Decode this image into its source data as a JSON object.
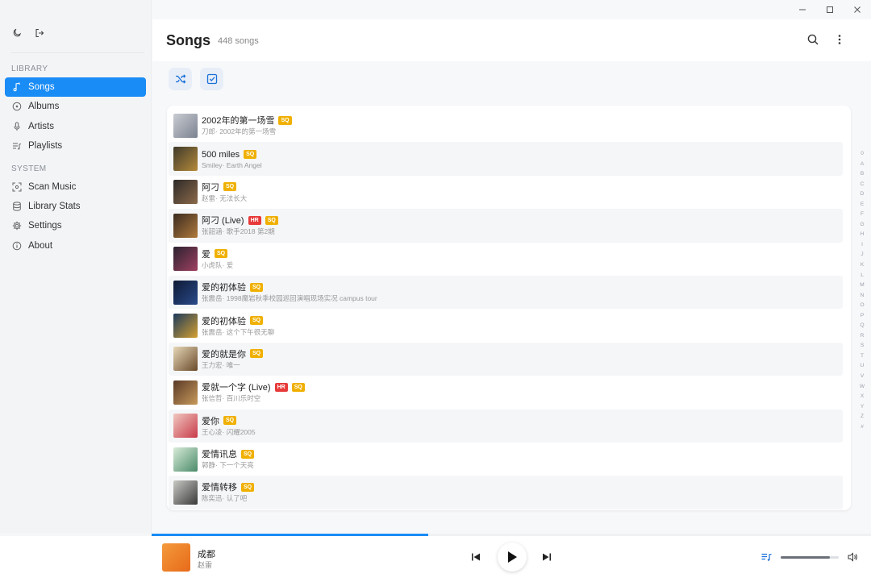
{
  "window": {
    "minimize_icon": "minimize-icon",
    "maximize_icon": "maximize-icon",
    "close_icon": "close-icon"
  },
  "sidebar": {
    "top_icons": [
      "moon-icon",
      "logout-icon"
    ],
    "library_label": "LIBRARY",
    "library_items": [
      {
        "label": "Songs",
        "icon": "music-note-icon",
        "active": true
      },
      {
        "label": "Albums",
        "icon": "disc-icon",
        "active": false
      },
      {
        "label": "Artists",
        "icon": "microphone-icon",
        "active": false
      },
      {
        "label": "Playlists",
        "icon": "playlist-icon",
        "active": false
      }
    ],
    "system_label": "SYSTEM",
    "system_items": [
      {
        "label": "Scan Music",
        "icon": "scan-icon"
      },
      {
        "label": "Library Stats",
        "icon": "database-icon"
      },
      {
        "label": "Settings",
        "icon": "gear-icon"
      },
      {
        "label": "About",
        "icon": "info-icon"
      }
    ]
  },
  "header": {
    "title": "Songs",
    "count": "448 songs"
  },
  "songs": [
    {
      "title": "2002年的第一场雪",
      "subtitle": "刀郎· 2002年的第一场雪",
      "badges": [
        "SQ"
      ],
      "art": [
        "#c9ccd2",
        "#7b8290"
      ]
    },
    {
      "title": "500 miles",
      "subtitle": "Smiley· Earth Angel",
      "badges": [
        "SQ"
      ],
      "art": [
        "#3e3a2c",
        "#b58a3a"
      ]
    },
    {
      "title": "阿刁",
      "subtitle": "赵雷· 无法长大",
      "badges": [
        "SQ"
      ],
      "art": [
        "#2d2a28",
        "#8c6a4a"
      ]
    },
    {
      "title": "阿刁 (Live)",
      "subtitle": "张韶涵· 歌手2018 第2期",
      "badges": [
        "HR",
        "SQ"
      ],
      "art": [
        "#3a2b20",
        "#b07a3c"
      ]
    },
    {
      "title": "爱",
      "subtitle": "小虎队· 爱",
      "badges": [
        "SQ"
      ],
      "art": [
        "#2a2230",
        "#a04060"
      ]
    },
    {
      "title": "爱的初体验",
      "subtitle": "张震岳· 1998魔岩秋季校园巡回演唱现场实况 campus tour",
      "badges": [
        "SQ"
      ],
      "art": [
        "#0e1a35",
        "#2a4a8a"
      ]
    },
    {
      "title": "爱的初体验",
      "subtitle": "张震岳· 这个下午很无聊",
      "badges": [
        "SQ"
      ],
      "art": [
        "#1c3a5c",
        "#d4a030"
      ]
    },
    {
      "title": "爱的就是你",
      "subtitle": "王力宏· 唯一",
      "badges": [
        "SQ"
      ],
      "art": [
        "#e6d8b8",
        "#6a4a2a"
      ]
    },
    {
      "title": "爱就一个字 (Live)",
      "subtitle": "张信哲· 百川乐时空",
      "badges": [
        "HR",
        "SQ"
      ],
      "art": [
        "#5a3a28",
        "#c89a5a"
      ]
    },
    {
      "title": "爱你",
      "subtitle": "王心凌· 闪耀2005",
      "badges": [
        "SQ"
      ],
      "art": [
        "#f0c8c0",
        "#c83a4a"
      ]
    },
    {
      "title": "爱情讯息",
      "subtitle": "郭静· 下一个天亮",
      "badges": [
        "SQ"
      ],
      "art": [
        "#d8ecd8",
        "#4a8a6a"
      ]
    },
    {
      "title": "爱情转移",
      "subtitle": "陈奕迅· 认了吧",
      "badges": [
        "SQ"
      ],
      "art": [
        "#c8c8c4",
        "#3a3a3a"
      ]
    }
  ],
  "alphabet": [
    "0",
    "A",
    "B",
    "C",
    "D",
    "E",
    "F",
    "G",
    "H",
    "I",
    "J",
    "K",
    "L",
    "M",
    "N",
    "O",
    "P",
    "Q",
    "R",
    "S",
    "T",
    "U",
    "V",
    "W",
    "X",
    "Y",
    "Z",
    "#"
  ],
  "player": {
    "title": "成都",
    "artist": "赵雷",
    "progress_fraction": 0.384,
    "volume_fraction": 0.85
  },
  "colors": {
    "accent": "#1a8cf5",
    "sq_badge": "#f0b000",
    "hr_badge": "#e83a3a"
  }
}
